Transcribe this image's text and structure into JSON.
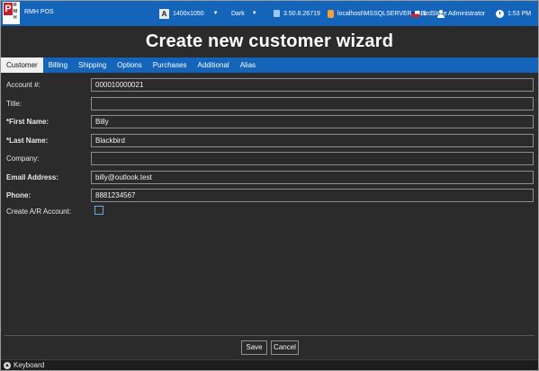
{
  "topbar": {
    "logo_letters": [
      "P",
      "R",
      "M",
      "H"
    ],
    "app_name": "RMH POS",
    "resolution": "1400x1050",
    "theme": "Dark",
    "version": "3.50.8.26719",
    "database": "localhost\\MSSQLSERVER01\\BirdStore",
    "register": "1",
    "user": "Administrator",
    "time": "1:53 PM",
    "colors": {
      "bar": "#1464b9",
      "logo_red": "#c0202a"
    }
  },
  "page": {
    "title": "Create new customer wizard"
  },
  "tabs": [
    {
      "label": "Customer",
      "active": true
    },
    {
      "label": "Billing",
      "active": false
    },
    {
      "label": "Shipping",
      "active": false
    },
    {
      "label": "Options",
      "active": false
    },
    {
      "label": "Purchases",
      "active": false
    },
    {
      "label": "Additional",
      "active": false
    },
    {
      "label": "Alias",
      "active": false
    }
  ],
  "form": {
    "account": {
      "label": "Account #:",
      "value": "000010000021"
    },
    "title": {
      "label": "Title:",
      "value": ""
    },
    "first_name": {
      "label": "*First Name:",
      "value": "Billy"
    },
    "last_name": {
      "label": "*Last Name:",
      "value": "Blackbird"
    },
    "company": {
      "label": "Company:",
      "value": ""
    },
    "email": {
      "label": "Email Address:",
      "value": "billy@outlook.test"
    },
    "phone": {
      "label": "Phone:",
      "value": "8881234567"
    },
    "create_ar": {
      "label": "Create A/R Account:",
      "checked": false
    }
  },
  "footer": {
    "save_label": "Save",
    "cancel_label": "Cancel",
    "keyboard_label": "Keyboard"
  }
}
